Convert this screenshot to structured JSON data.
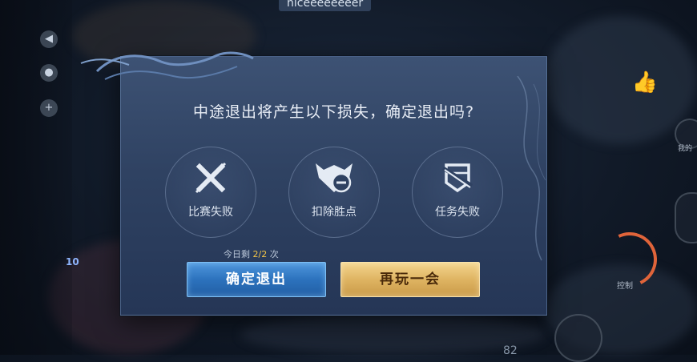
{
  "background": {
    "player_name": "niceeeeeeeer",
    "level": "10",
    "control_label": "控制",
    "right_side_label": "我的",
    "bottom_number": "82"
  },
  "dialog": {
    "title": "中途退出将产生以下损失，确定退出吗?",
    "options": [
      {
        "label": "比赛失败",
        "icon": "cross-icon"
      },
      {
        "label": "扣除胜点",
        "icon": "badge-minus-icon"
      },
      {
        "label": "任务失败",
        "icon": "broken-shield-icon"
      }
    ],
    "remaining": {
      "prefix": "今日剩",
      "count": "2/2",
      "suffix": "次"
    },
    "buttons": {
      "exit": "确定退出",
      "play": "再玩一会"
    }
  },
  "colors": {
    "dialog_bg": "#2f4262",
    "exit_button": "#2c72bd",
    "play_button": "#dfb462",
    "highlight_count": "#f2c447"
  }
}
